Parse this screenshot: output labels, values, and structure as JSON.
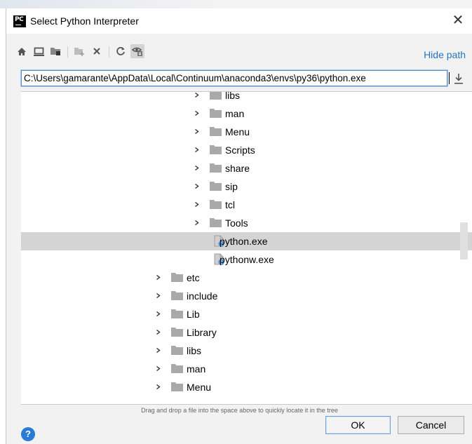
{
  "window": {
    "title": "Select Python Interpreter",
    "app_icon_text": "PC"
  },
  "toolbar": {
    "hide_path_label": "Hide path",
    "buttons": [
      {
        "icon": "home-icon",
        "enabled": true
      },
      {
        "icon": "desktop-icon",
        "enabled": true
      },
      {
        "icon": "project-folder-icon",
        "enabled": true
      },
      {
        "icon": "new-folder-icon",
        "enabled": false
      },
      {
        "icon": "delete-icon",
        "enabled": true
      },
      {
        "icon": "refresh-icon",
        "enabled": true
      },
      {
        "icon": "show-hidden-icon",
        "enabled": true,
        "active": true
      }
    ]
  },
  "path": {
    "value": "C:\\Users\\gamarante\\AppData\\Local\\Continuum\\anaconda3\\envs\\py36\\python.exe"
  },
  "tree": {
    "items": [
      {
        "label": "libs",
        "type": "folder",
        "level": 2
      },
      {
        "label": "man",
        "type": "folder",
        "level": 2
      },
      {
        "label": "Menu",
        "type": "folder",
        "level": 2
      },
      {
        "label": "Scripts",
        "type": "folder",
        "level": 2
      },
      {
        "label": "share",
        "type": "folder",
        "level": 2
      },
      {
        "label": "sip",
        "type": "folder",
        "level": 2
      },
      {
        "label": "tcl",
        "type": "folder",
        "level": 2
      },
      {
        "label": "Tools",
        "type": "folder",
        "level": 2
      },
      {
        "label": "python.exe",
        "type": "file",
        "level": 2,
        "selected": true
      },
      {
        "label": "pythonw.exe",
        "type": "file",
        "level": 2
      },
      {
        "label": "etc",
        "type": "folder",
        "level": 1
      },
      {
        "label": "include",
        "type": "folder",
        "level": 1
      },
      {
        "label": "Lib",
        "type": "folder",
        "level": 1
      },
      {
        "label": "Library",
        "type": "folder",
        "level": 1
      },
      {
        "label": "libs",
        "type": "folder",
        "level": 1
      },
      {
        "label": "man",
        "type": "folder",
        "level": 1
      },
      {
        "label": "Menu",
        "type": "folder",
        "level": 1
      }
    ]
  },
  "hint_text": "Drag and drop a file into the space above to quickly locate it in the tree",
  "buttons": {
    "ok": "OK",
    "cancel": "Cancel",
    "help": "?"
  },
  "colors": {
    "accent": "#2675bf",
    "selection": "#d4d4d4",
    "folder": "#a9a9a9",
    "help": "#2a7ad8"
  }
}
